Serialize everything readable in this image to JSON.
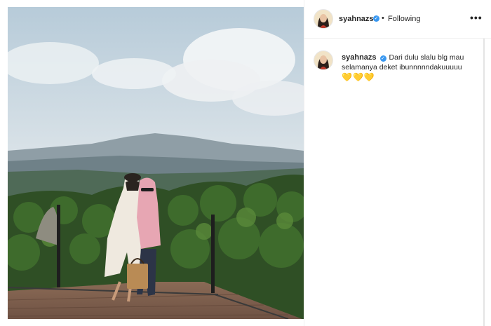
{
  "post": {
    "author": {
      "username": "syahnazs",
      "verified": true,
      "follow_status": "Following",
      "separator": "•"
    },
    "more_options": "•••",
    "caption": {
      "username": "syahnazs",
      "text": "Dari dulu slalu blg mau selamanya deket ibunnnnndakuuuuu",
      "emoji": "💛💛💛"
    },
    "photo": {
      "icon": "photo"
    }
  },
  "colors": {
    "verified": "#3897f0",
    "border": "#efefef",
    "text": "#262626"
  }
}
